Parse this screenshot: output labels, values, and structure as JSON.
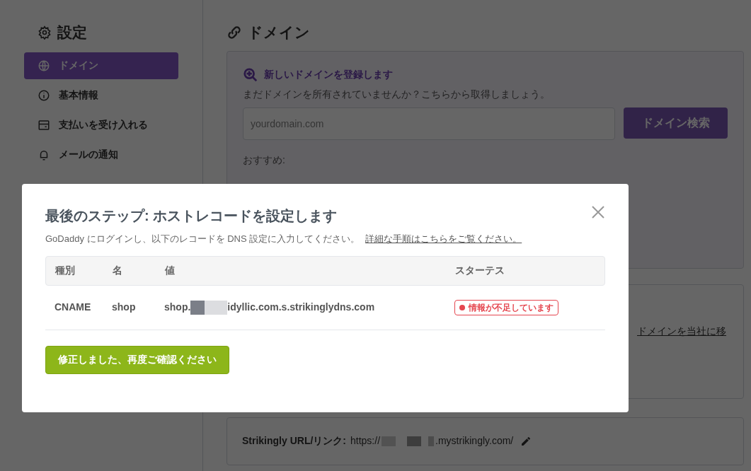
{
  "sidebar": {
    "title": "設定",
    "items": [
      {
        "label": "ドメイン",
        "selected": true
      },
      {
        "label": "基本情報",
        "selected": false
      },
      {
        "label": "支払いを受け入れる",
        "selected": false
      },
      {
        "label": "メールの通知",
        "selected": false
      }
    ]
  },
  "main": {
    "title": "ドメイン",
    "register_card": {
      "heading": "新しいドメインを登録します",
      "description": "まだドメインを所有されていませんか？こちらから取得しましょう。",
      "search": {
        "placeholder": "yourdomain.com"
      },
      "search_button": "ドメイン検索",
      "suggestions_label": "おすすめ:"
    },
    "transfer_card": {
      "link": "ドメインを当社に移"
    },
    "url_card": {
      "label": "Strikingly URL/リンク:",
      "prefix": "https://",
      "suffix": ".mystrikingly.com/"
    }
  },
  "modal": {
    "title": "最後のステップ: ホストレコードを設定します",
    "description": "GoDaddy にログインし、以下のレコードを DNS 設定に入力してください。",
    "help_link": "詳細な手順はこちらをご覧ください。",
    "table": {
      "columns": [
        "種別",
        "名",
        "値",
        "スターテス"
      ],
      "rows": [
        {
          "type": "CNAME",
          "name": "shop",
          "value_prefix": "shop.",
          "value_suffix": "idyllic.com.s.strikinglydns.com",
          "status": "情報が不足しています",
          "color": "#e5464f"
        }
      ]
    },
    "confirm_button": "修正しました、再度ご確認ください"
  }
}
